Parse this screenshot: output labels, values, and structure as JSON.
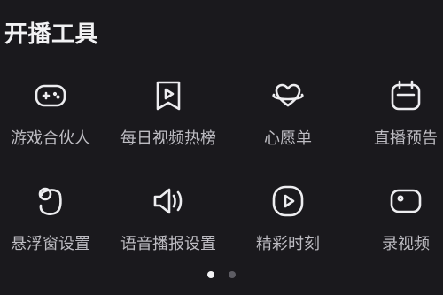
{
  "section": {
    "title": "开播工具"
  },
  "tools": [
    {
      "label": "游戏合伙人",
      "icon": "gamepad-icon"
    },
    {
      "label": "每日视频热榜",
      "icon": "bookmark-icon"
    },
    {
      "label": "心愿单",
      "icon": "heart-planet-icon"
    },
    {
      "label": "直播预告",
      "icon": "calendar-icon"
    },
    {
      "label": "悬浮窗设置",
      "icon": "floating-window-icon"
    },
    {
      "label": "语音播报设置",
      "icon": "speaker-icon"
    },
    {
      "label": "精彩时刻",
      "icon": "play-circle-icon"
    },
    {
      "label": "录视频",
      "icon": "video-camera-icon"
    }
  ],
  "pagination": {
    "active": 1,
    "total": 2
  }
}
